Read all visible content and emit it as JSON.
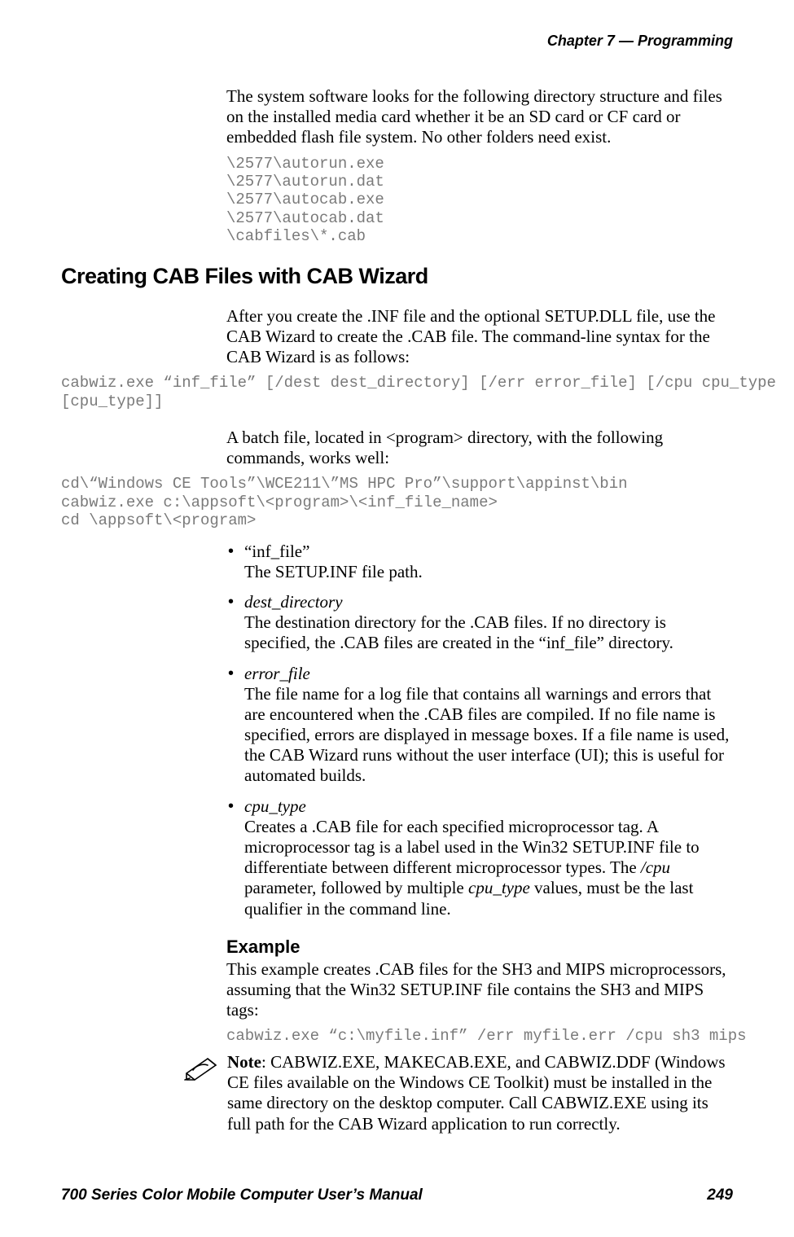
{
  "header": {
    "chapter_label": "Chapter 7",
    "dash": "—",
    "chapter_title": "Programming"
  },
  "intro_para": "The system software looks for the following directory structure and files on the installed media card whether it be an SD card or CF card or embedded flash file system. No other folders need exist.",
  "dir_listing": "\\2577\\autorun.exe\n\\2577\\autorun.dat\n\\2577\\autocab.exe\n\\2577\\autocab.dat\n\\cabfiles\\*.cab",
  "section_heading": "Creating CAB Files with CAB Wizard",
  "after_heading_para": "After you create the .INF file and the optional SETUP.DLL file, use the CAB Wizard to create the .CAB file. The command-line syntax for the CAB Wizard is as follows:",
  "cabwiz_syntax": "cabwiz.exe “inf_file” [/dest dest_directory] [/err error_file] [/cpu cpu_type\n[cpu_type]]",
  "batch_intro": "A batch file, located in <program> directory, with the following commands, works well:",
  "batch_code": "cd\\“Windows CE Tools”\\WCE211\\”MS HPC Pro”\\support\\appinst\\bin\ncabwiz.exe c:\\appsoft\\<program>\\<inf_file_name>\ncd \\appsoft\\<program>",
  "params": {
    "inf_file": {
      "label": "“inf_file”",
      "desc": "The SETUP.INF file path."
    },
    "dest_directory": {
      "label": "dest_directory",
      "desc": "The destination directory for the .CAB files. If no directory is specified, the .CAB files are created in the “inf_file” directory."
    },
    "error_file": {
      "label": "error_file",
      "desc": "The file name for a log file that contains all warnings and errors that are encountered when the .CAB files are compiled. If no file name is specified, errors are displayed in message boxes. If a file name is used, the CAB Wizard runs without the user interface (UI); this is useful for automated builds."
    },
    "cpu_type": {
      "label": "cpu_type",
      "desc_pre": "Creates a .CAB file for each specified microprocessor tag. A microprocessor tag is a label used in the Win32 SETUP.INF file to differentiate between different microprocessor types. The ",
      "cpu_param": "/cpu",
      "desc_mid": " parameter, followed by multiple ",
      "cpu_type_i": "cpu_type",
      "desc_post": " values, must be the last qualifier in the command line."
    }
  },
  "example_heading": "Example",
  "example_para": "This example creates .CAB files for the SH3 and MIPS microprocessors, assuming that the Win32 SETUP.INF file contains the SH3 and MIPS tags:",
  "example_code": "cabwiz.exe “c:\\myfile.inf” /err myfile.err /cpu sh3 mips",
  "note": {
    "label": "Note",
    "text": ": CABWIZ.EXE, MAKECAB.EXE, and CABWIZ.DDF (Windows CE files available on the Windows CE Toolkit) must be installed in the same directory on the desktop computer. Call CABWIZ.EXE using its full path for the CAB Wizard application to run correctly."
  },
  "footer": {
    "left": "700 Series Color Mobile Computer User’s Manual",
    "right": "249"
  }
}
